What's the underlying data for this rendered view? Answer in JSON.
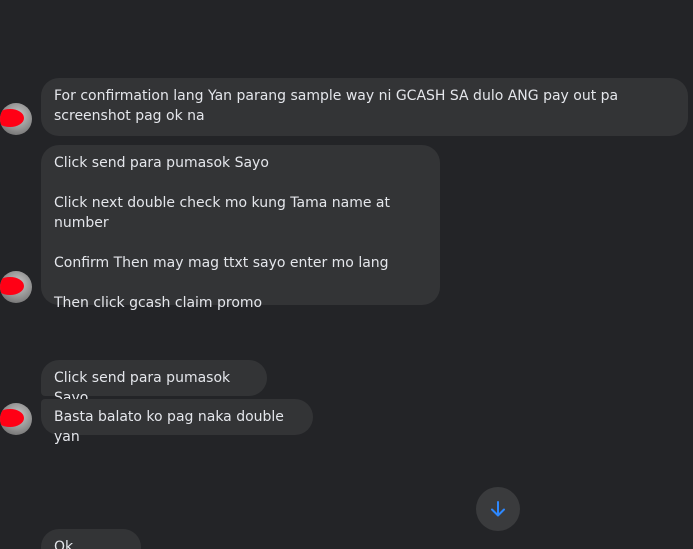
{
  "messages": {
    "group1": {
      "msg1": "For confirmation lang Yan parang sample way ni GCASH SA dulo ANG pay out pa screenshot pag ok na"
    },
    "group2": {
      "msg1": "Click send para pumasok Sayo\n\nClick next double check mo kung Tama name at number\n\nConfirm Then may mag ttxt sayo enter mo lang\n\nThen click gcash claim promo"
    },
    "group3": {
      "msg1": "Click send para pumasok Sayo",
      "msg2": "Basta balato ko pag naka double yan"
    },
    "group4": {
      "msg1": "Ok salamat"
    }
  },
  "icons": {
    "scroll_down": "arrow-down-icon",
    "avatar": "avatar-icon"
  },
  "colors": {
    "background": "#232427",
    "bubble": "#333436",
    "text": "#e4e6eb",
    "accent": "#2d88ff",
    "redaction": "#ff0015"
  }
}
